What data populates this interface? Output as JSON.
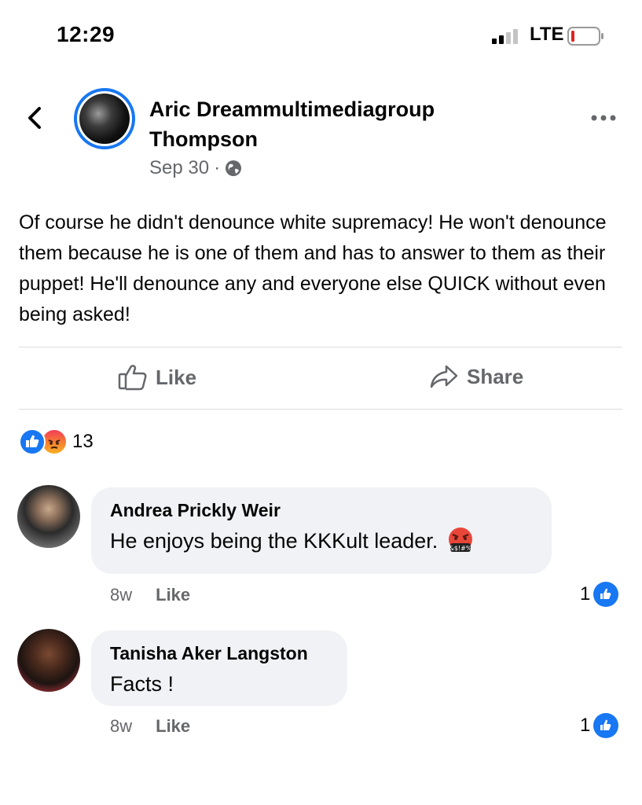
{
  "status_bar": {
    "time": "12:29",
    "network": "LTE",
    "battery_color": "#e02424"
  },
  "post": {
    "author": "Aric Dreammultimediagroup Thompson",
    "date": "Sep 30",
    "separator": "·",
    "audience_icon": "globe-icon",
    "text": "Of course he didn't denounce white supremacy! He won't denounce them because he is one of them and has to answer to them as their puppet! He'll denounce any and everyone else QUICK without even being asked!"
  },
  "actions": {
    "like_label": "Like",
    "share_label": "Share"
  },
  "reactions": {
    "types": [
      "like",
      "angry"
    ],
    "count": "13"
  },
  "comments": [
    {
      "author": "Andrea Prickly Weir",
      "text": "He enjoys being the KKKult leader.",
      "emoji": "cursing-face-emoji",
      "age": "8w",
      "like_label": "Like",
      "like_count": "1"
    },
    {
      "author": "Tanisha Aker Langston",
      "text": "Facts !",
      "age": "8w",
      "like_label": "Like",
      "like_count": "1"
    }
  ],
  "colors": {
    "accent": "#1877f2",
    "secondary_text": "#65676b",
    "bubble": "#f0f2f5"
  }
}
